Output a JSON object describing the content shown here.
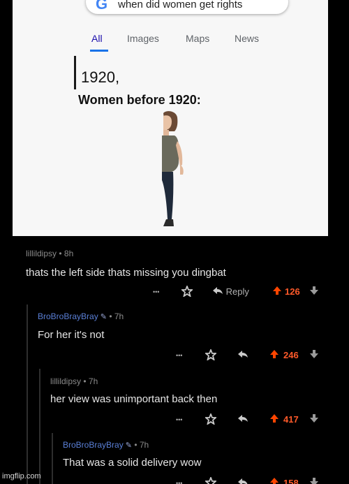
{
  "search": {
    "logo": "G",
    "query": "when did women get rights",
    "tabs": [
      {
        "label": "All"
      },
      {
        "label": "Images"
      },
      {
        "label": "Maps"
      },
      {
        "label": "News"
      }
    ],
    "answer": "1920,"
  },
  "meme": {
    "caption": "Women before 1920:"
  },
  "comments": [
    {
      "user": "lillildipsy",
      "age": "• 8h",
      "text": "thats the left side thats missing you dingbat",
      "more": "•••",
      "reply_label": "Reply",
      "score": "126"
    },
    {
      "user": "BroBroBrayBray",
      "age": "• 7h",
      "text": "For her it's not",
      "more": "•••",
      "score": "246"
    },
    {
      "user": "lillildipsy",
      "age": "• 7h",
      "text": "her view was unimportant back then",
      "more": "•••",
      "score": "417"
    },
    {
      "user": "BroBroBrayBray",
      "age": "• 7h",
      "text": "That was a solid delivery wow",
      "more": "•••",
      "score": "158"
    }
  ],
  "colors": {
    "upvote": "#ff4500",
    "username_blue": "#5a7fd6",
    "background": "#000000",
    "google_tab_underline": "#1a73e8"
  },
  "icons": {
    "award": "award-icon",
    "reply": "reply-arrow-icon",
    "upvote": "upvote-arrow-icon",
    "downvote": "downvote-arrow-icon",
    "moderator": "pencil-icon"
  },
  "watermark": "imgflip.com"
}
